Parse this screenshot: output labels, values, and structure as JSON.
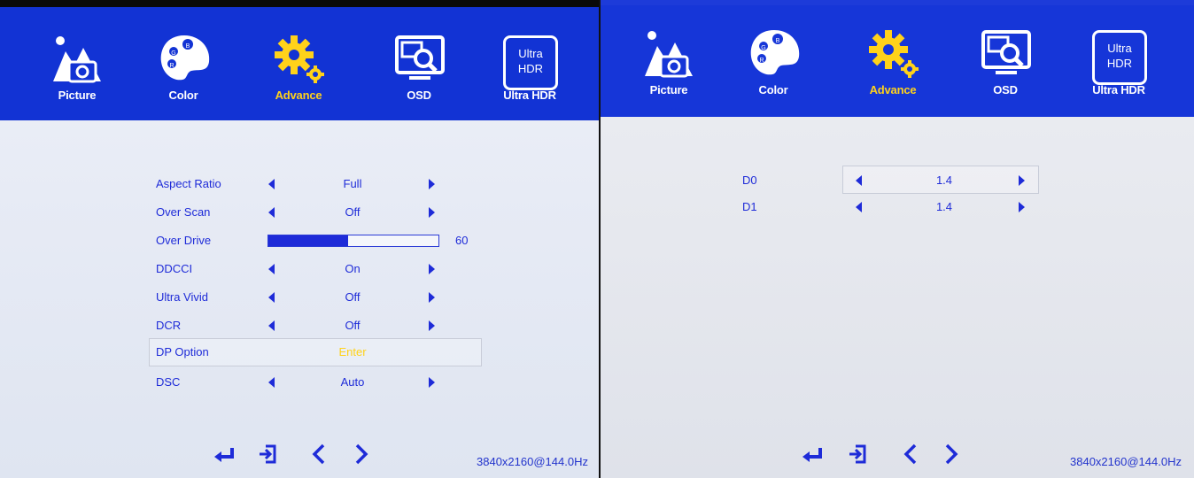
{
  "left": {
    "tabs": [
      {
        "label": "Picture",
        "icon": "picture-icon"
      },
      {
        "label": "Color",
        "icon": "palette-icon"
      },
      {
        "label": "Advance",
        "icon": "gear-icon",
        "active": true
      },
      {
        "label": "OSD",
        "icon": "monitor-search-icon"
      },
      {
        "label": "Ultra HDR",
        "icon": "ultra-hdr-icon",
        "icon_text": [
          "Ultra",
          "HDR"
        ]
      }
    ],
    "menu": [
      {
        "name": "Aspect Ratio",
        "value": "Full"
      },
      {
        "name": "Over Scan",
        "value": "Off"
      },
      {
        "name": "Over Drive",
        "value": "60",
        "level": 0.47
      },
      {
        "name": "DDCCI",
        "value": "On"
      },
      {
        "name": "Ultra Vivid",
        "value": "Off"
      },
      {
        "name": "DCR",
        "value": "Off"
      },
      {
        "name": "DP Option",
        "value": "Enter",
        "selected": true
      },
      {
        "name": "DSC",
        "value": "Auto"
      }
    ],
    "resolution": "3840x2160@144.0Hz"
  },
  "right": {
    "tabs": [
      {
        "label": "Picture",
        "icon": "picture-icon"
      },
      {
        "label": "Color",
        "icon": "palette-icon"
      },
      {
        "label": "Advance",
        "icon": "gear-icon",
        "active": true
      },
      {
        "label": "OSD",
        "icon": "monitor-search-icon"
      },
      {
        "label": "Ultra HDR",
        "icon": "ultra-hdr-icon",
        "icon_text": [
          "Ultra",
          "HDR"
        ]
      }
    ],
    "menu": [
      {
        "name": "D0",
        "value": "1.4",
        "selected": true
      },
      {
        "name": "D1",
        "value": "1.4"
      }
    ],
    "resolution": "3840x2160@144.0Hz"
  },
  "colors": {
    "header": "#1233d4",
    "text": "#1e2bd8",
    "active": "#ffd21a"
  },
  "footer_icons": [
    "enter-icon",
    "exit-icon",
    "left-arrow-icon",
    "right-arrow-icon"
  ]
}
